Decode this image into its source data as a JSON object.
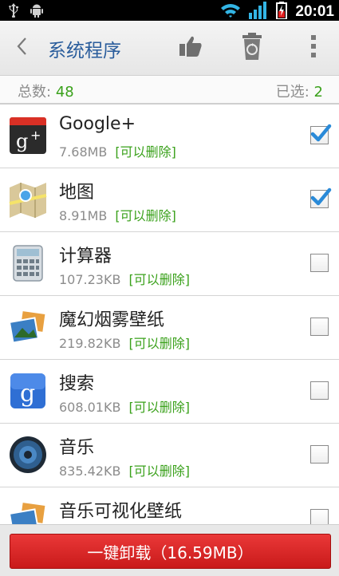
{
  "status_bar": {
    "time": "20:01",
    "icons": [
      "usb-icon",
      "android-debug-icon",
      "wifi-icon",
      "signal-icon",
      "battery-charging-icon"
    ]
  },
  "header": {
    "title": "系统程序",
    "actions": [
      "back-icon",
      "thumbs-up-icon",
      "recycle-bin-icon",
      "overflow-menu-icon"
    ]
  },
  "summary": {
    "total_label": "总数:",
    "total_value": "48",
    "selected_label": "已选:",
    "selected_value": "2"
  },
  "apps": [
    {
      "name": "Google+",
      "size": "7.68MB",
      "tag": "[可以删除]",
      "checked": true,
      "icon": "google-plus-icon"
    },
    {
      "name": "地图",
      "size": "8.91MB",
      "tag": "[可以删除]",
      "checked": true,
      "icon": "maps-icon"
    },
    {
      "name": "计算器",
      "size": "107.23KB",
      "tag": "[可以删除]",
      "checked": false,
      "icon": "calculator-icon"
    },
    {
      "name": "魔幻烟雾壁纸",
      "size": "219.82KB",
      "tag": "[可以删除]",
      "checked": false,
      "icon": "wallpaper-icon"
    },
    {
      "name": "搜索",
      "size": "608.01KB",
      "tag": "[可以删除]",
      "checked": false,
      "icon": "google-search-icon"
    },
    {
      "name": "音乐",
      "size": "835.42KB",
      "tag": "[可以删除]",
      "checked": false,
      "icon": "music-speaker-icon"
    },
    {
      "name": "音乐可视化壁纸",
      "size": "",
      "tag": "",
      "checked": false,
      "icon": "wallpaper-icon"
    }
  ],
  "footer": {
    "uninstall_label": "一键卸载（16.59MB）"
  },
  "colors": {
    "title_blue": "#2a5d9c",
    "green": "#3aa11b",
    "uninstall_red": "#d62626"
  }
}
